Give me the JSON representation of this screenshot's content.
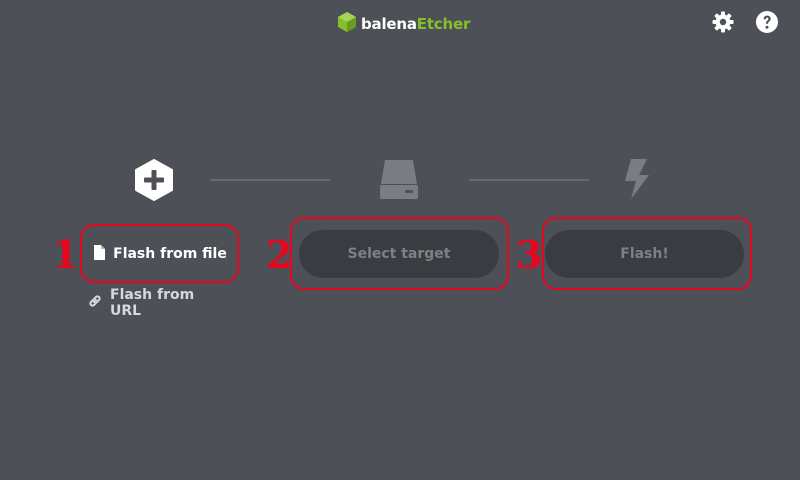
{
  "header": {
    "brand_part1": "balena",
    "brand_part2": "Etcher",
    "logo_icon": "cube-logo-icon",
    "settings_icon": "gear-icon",
    "help_icon": "help-icon"
  },
  "steps": {
    "source": {
      "icon": "plus-hexagon-icon",
      "flash_from_file": "Flash from file",
      "flash_from_url": "Flash from URL"
    },
    "target": {
      "icon": "drive-icon",
      "button_label": "Select target"
    },
    "flash": {
      "icon": "lightning-icon",
      "button_label": "Flash!"
    }
  },
  "annotations": {
    "numbers": [
      "1",
      "2",
      "3"
    ],
    "color": "#e8061f"
  },
  "colors": {
    "background": "#4d5057",
    "accent": "#85c02b",
    "disabled_pill": "#3a3c41",
    "disabled_text": "#7d8085"
  }
}
